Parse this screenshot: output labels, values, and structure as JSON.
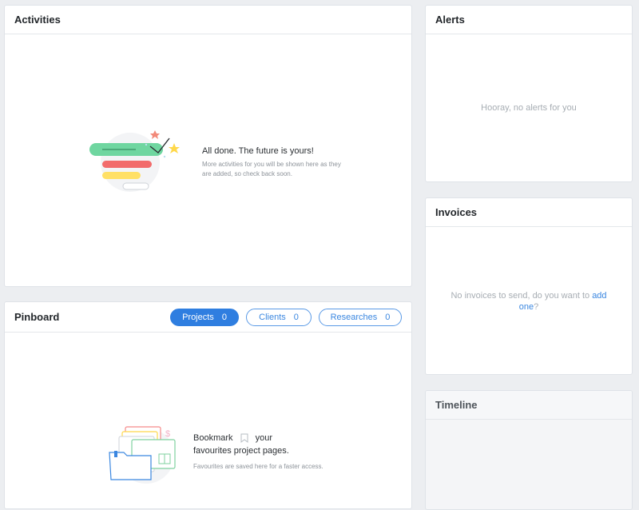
{
  "activities": {
    "title": "Activities",
    "empty_title": "All done. The future is yours!",
    "empty_subtitle": "More activities for you will be shown here as they are added, so check back soon."
  },
  "alerts": {
    "title": "Alerts",
    "empty": "Hooray, no alerts for you"
  },
  "invoices": {
    "title": "Invoices",
    "empty_prefix": "No invoices to send, do you want to",
    "empty_link": "add one",
    "empty_suffix": "?"
  },
  "timeline": {
    "title": "Timeline"
  },
  "pinboard": {
    "title": "Pinboard",
    "tabs": [
      {
        "label": "Projects",
        "count": "0",
        "active": true
      },
      {
        "label": "Clients",
        "count": "0",
        "active": false
      },
      {
        "label": "Researches",
        "count": "0",
        "active": false
      }
    ],
    "empty_before_icon": "Bookmark",
    "empty_after_icon": "your",
    "empty_line2": "favourites project pages.",
    "empty_subtitle": "Favourites are saved here for a faster access."
  },
  "colors": {
    "accent": "#2f7ee0",
    "link": "#3b87e0",
    "page_bg": "#eceef1"
  }
}
